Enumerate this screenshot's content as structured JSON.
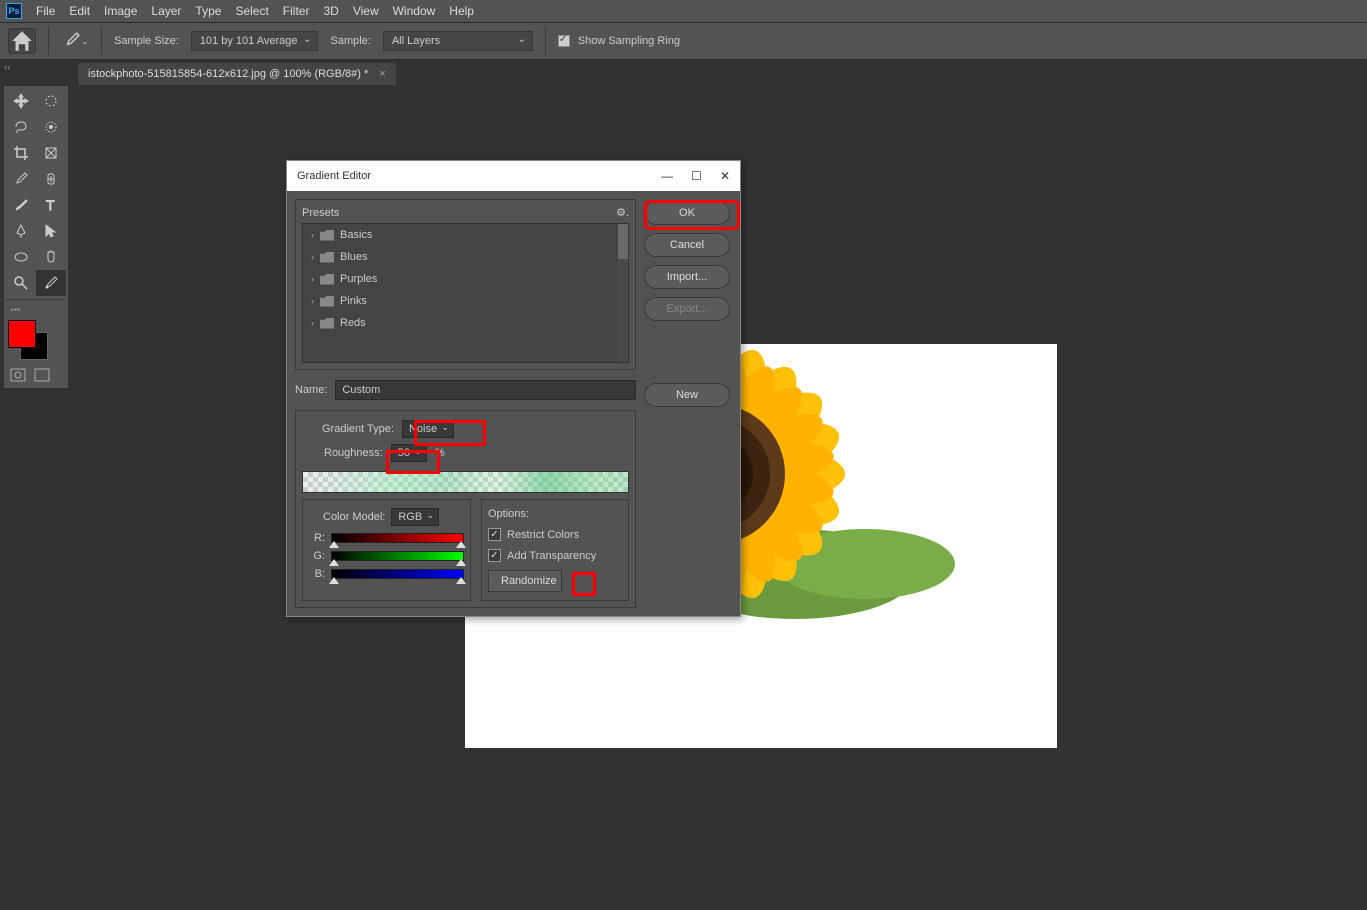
{
  "menubar": {
    "items": [
      "File",
      "Edit",
      "Image",
      "Layer",
      "Type",
      "Select",
      "Filter",
      "3D",
      "View",
      "Window",
      "Help"
    ]
  },
  "optbar": {
    "sampleSize_label": "Sample Size:",
    "sampleSize_value": "101 by 101 Average",
    "sample_label": "Sample:",
    "sample_value": "All Layers",
    "showSampling": "Show Sampling Ring"
  },
  "tab": {
    "title": "istockphoto-515815854-612x612.jpg @ 100% (RGB/8#) *"
  },
  "dialog": {
    "title": "Gradient Editor",
    "presets_label": "Presets",
    "presets": [
      "Basics",
      "Blues",
      "Purples",
      "Pinks",
      "Reds"
    ],
    "ok": "OK",
    "cancel": "Cancel",
    "import": "Import...",
    "export": "Export...",
    "new": "New",
    "name_label": "Name:",
    "name_value": "Custom",
    "gradType_label": "Gradient Type:",
    "gradType_value": "Noise",
    "roughness_label": "Roughness:",
    "roughness_value": "50",
    "roughness_pct": "%",
    "colorModel_label": "Color Model:",
    "colorModel_value": "RGB",
    "options_label": "Options:",
    "r": "R:",
    "g": "G:",
    "b": "B:",
    "restrict": "Restrict Colors",
    "addTrans": "Add Transparency",
    "randomize": "Randomize"
  },
  "colors": {
    "fg": "#ff0000",
    "bg": "#000000"
  }
}
